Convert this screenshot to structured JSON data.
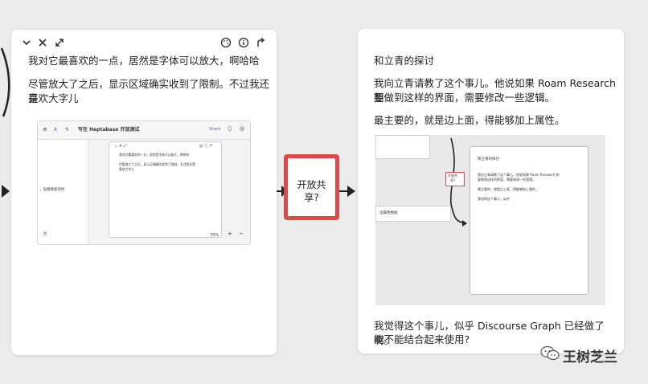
{
  "left_card": {
    "toolbar": {
      "collapse_icon": "chevron-down-icon",
      "close_icon": "close-icon",
      "expand_icon": "expand-icon",
      "palette_icon": "palette-icon",
      "info_icon": "info-icon",
      "share_icon": "share-arrow-icon"
    },
    "para1": "我对它最喜欢的一点，居然是字体可以放大，啊哈哈",
    "para2_line1": "尽管放大了之后，显示区域确实收到了限制。不过我还是",
    "para2_line2": "喜欢大字儿",
    "screenshot": {
      "title": "写在 Heptabase 开放测试",
      "share": "Share",
      "card_line1": "我对它最喜欢的一点，居然是字体可以放大，啊哈哈",
      "card_line2": "尽管放大了之后，显示区域确实收到了限制。不过我还是",
      "card_line3": "喜欢大字儿",
      "side_text": "，设想探索的时",
      "zoom": "70%",
      "minus": "−",
      "plus": "+"
    }
  },
  "middle_node": {
    "label_line1": "开放共",
    "label_line2": "享?"
  },
  "right_card": {
    "heading": "和立青的探讨",
    "para1_line1": "我向立青请教了这个事儿。他说如果 Roam Research 想",
    "para1_line2": "要做到这样的界面，需要修改一些逻辑。",
    "para2": "最主要的，就是边上面，得能够加上属性。",
    "screenshot": {
      "inner_title": "和立青的探讨",
      "inner_line1": "我向立青请教了这个事儿。他说如果 Roam Research 想",
      "inner_line2": "要做到这样的界面，需要修改一些逻辑。",
      "inner_line3": "最主要的，就是边上面，得能够加上属性。",
      "inner_line4": "我觉得这个事儿，似乎",
      "node_label_line1": "开放共",
      "node_label_line2": "享?",
      "side_label": "边属性数据"
    },
    "para3_line1": "我觉得这个事儿，似乎 Discourse Graph 已经做了啊。",
    "para3_line2": "能不能结合起来使用?"
  },
  "watermark": {
    "icon": "wechat-icon",
    "text": "王树芝兰"
  },
  "colors": {
    "accent_red": "#e04848",
    "card_bg": "#ffffff",
    "canvas_bg": "#ececec"
  }
}
